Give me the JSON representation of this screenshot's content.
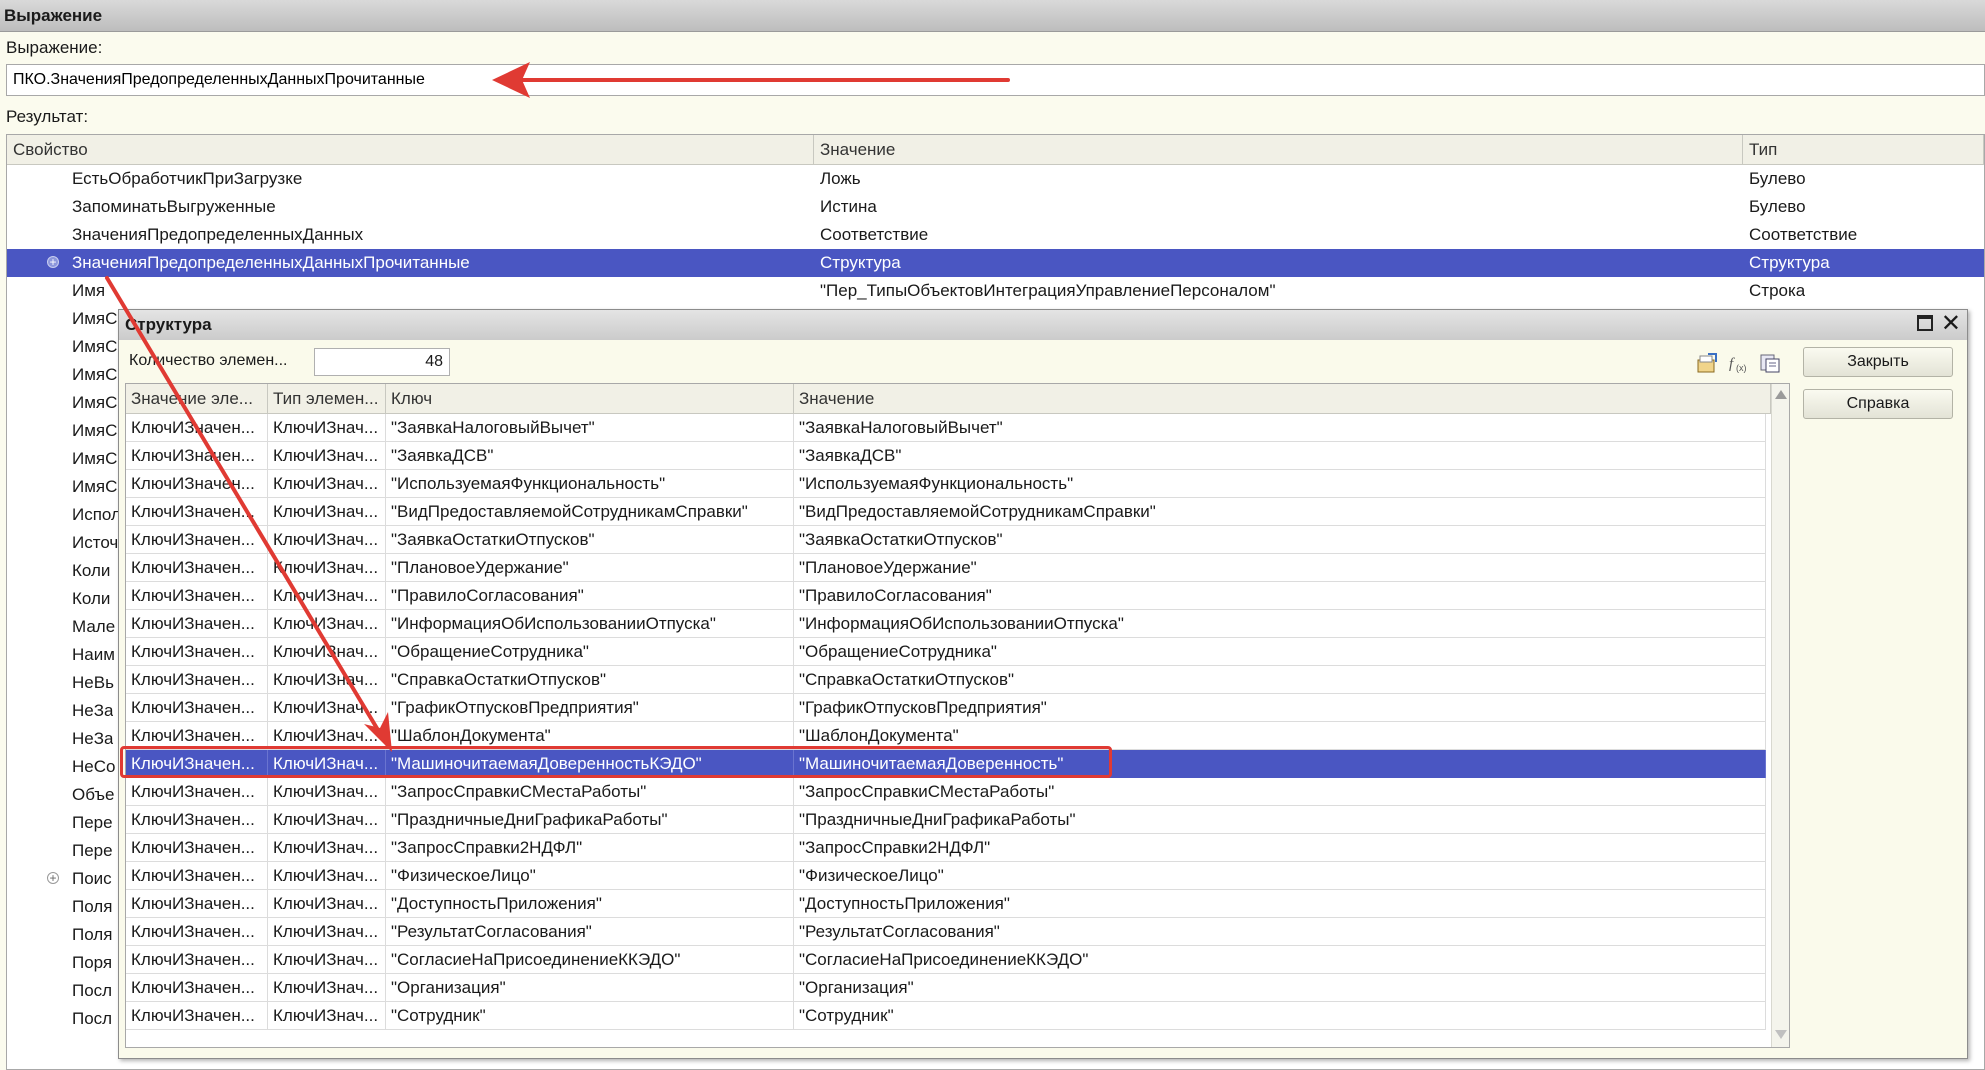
{
  "window": {
    "title": "Выражение",
    "expression_label": "Выражение:",
    "expression_value": "ПКО.ЗначенияПредопределенныхДанныхПрочитанные",
    "result_label": "Результат:"
  },
  "result_grid": {
    "columns": [
      "Свойство",
      "Значение",
      "Тип"
    ],
    "rows": [
      {
        "prop": "ЕстьОбработчикПриЗагрузке",
        "value": "Ложь",
        "type": "Булево"
      },
      {
        "prop": "ЗапоминатьВыгруженные",
        "value": "Истина",
        "type": "Булево"
      },
      {
        "prop": "ЗначенияПредопределенныхДанных",
        "value": "Соответствие",
        "type": "Соответствие"
      },
      {
        "prop": "ЗначенияПредопределенныхДанныхПрочитанные",
        "value": "Структура",
        "type": "Структура",
        "selected": true,
        "expander": "+"
      },
      {
        "prop": "Имя",
        "value": "\"Пер_ТипыОбъектовИнтеграцияУправлениеПерсоналом\"",
        "type": "Строка"
      },
      {
        "prop": "ИмяС",
        "value": "",
        "type": ""
      },
      {
        "prop": "ИмяС",
        "value": "",
        "type": ""
      },
      {
        "prop": "ИмяС",
        "value": "",
        "type": ""
      },
      {
        "prop": "ИмяС",
        "value": "",
        "type": ""
      },
      {
        "prop": "ИмяС",
        "value": "",
        "type": ""
      },
      {
        "prop": "ИмяС",
        "value": "",
        "type": ""
      },
      {
        "prop": "ИмяС",
        "value": "",
        "type": ""
      },
      {
        "prop": "Испол",
        "value": "",
        "type": ""
      },
      {
        "prop": "Источ",
        "value": "",
        "type": ""
      },
      {
        "prop": "Коли",
        "value": "",
        "type": ""
      },
      {
        "prop": "Коли",
        "value": "",
        "type": ""
      },
      {
        "prop": "Мале",
        "value": "",
        "type": ""
      },
      {
        "prop": "Наим",
        "value": "",
        "type": ""
      },
      {
        "prop": "НеВь",
        "value": "",
        "type": ""
      },
      {
        "prop": "НеЗа",
        "value": "",
        "type": ""
      },
      {
        "prop": "НеЗа",
        "value": "",
        "type": ""
      },
      {
        "prop": "НеСо",
        "value": "",
        "type": ""
      },
      {
        "prop": "Объе",
        "value": "",
        "type": ""
      },
      {
        "prop": "Пере",
        "value": "",
        "type": ""
      },
      {
        "prop": "Пере",
        "value": "",
        "type": ""
      },
      {
        "prop": "Поис",
        "value": "",
        "type": "",
        "expander": "+"
      },
      {
        "prop": "Поля",
        "value": "",
        "type": ""
      },
      {
        "prop": "Поля",
        "value": "",
        "type": ""
      },
      {
        "prop": "Поря",
        "value": "",
        "type": ""
      },
      {
        "prop": "Посл",
        "value": "",
        "type": ""
      },
      {
        "prop": "Посл",
        "value": "",
        "type": ""
      }
    ]
  },
  "structure_dialog": {
    "title": "Структура",
    "count_label": "Количество элемен...",
    "count_value": "48",
    "close_button": "Закрыть",
    "help_button": "Справка",
    "icons": [
      "open-value-icon",
      "fx-expression-icon",
      "copy-icon"
    ],
    "columns": [
      "Значение эле...",
      "Тип элемен...",
      "Ключ",
      "Значение"
    ],
    "rows": [
      {
        "c1": "КлючИЗначен...",
        "c2": "КлючИЗнач...",
        "key": "\"ЗаявкаНалоговыйВычет\"",
        "val": "\"ЗаявкаНалоговыйВычет\""
      },
      {
        "c1": "КлючИЗначен...",
        "c2": "КлючИЗнач...",
        "key": "\"ЗаявкаДСВ\"",
        "val": "\"ЗаявкаДСВ\""
      },
      {
        "c1": "КлючИЗначен...",
        "c2": "КлючИЗнач...",
        "key": "\"ИспользуемаяФункциональность\"",
        "val": "\"ИспользуемаяФункциональность\""
      },
      {
        "c1": "КлючИЗначен...",
        "c2": "КлючИЗнач...",
        "key": "\"ВидПредоставляемойСотрудникамСправки\"",
        "val": "\"ВидПредоставляемойСотрудникамСправки\""
      },
      {
        "c1": "КлючИЗначен...",
        "c2": "КлючИЗнач...",
        "key": "\"ЗаявкаОстаткиОтпусков\"",
        "val": "\"ЗаявкаОстаткиОтпусков\""
      },
      {
        "c1": "КлючИЗначен...",
        "c2": "КлючИЗнач...",
        "key": "\"ПлановоеУдержание\"",
        "val": "\"ПлановоеУдержание\""
      },
      {
        "c1": "КлючИЗначен...",
        "c2": "КлючИЗнач...",
        "key": "\"ПравилоСогласования\"",
        "val": "\"ПравилоСогласования\""
      },
      {
        "c1": "КлючИЗначен...",
        "c2": "КлючИЗнач...",
        "key": "\"ИнформацияОбИспользованииОтпуска\"",
        "val": "\"ИнформацияОбИспользованииОтпуска\""
      },
      {
        "c1": "КлючИЗначен...",
        "c2": "КлючИЗнач...",
        "key": "\"ОбращениеСотрудника\"",
        "val": "\"ОбращениеСотрудника\""
      },
      {
        "c1": "КлючИЗначен...",
        "c2": "КлючИЗнач...",
        "key": "\"СправкаОстаткиОтпусков\"",
        "val": "\"СправкаОстаткиОтпусков\""
      },
      {
        "c1": "КлючИЗначен...",
        "c2": "КлючИЗнач...",
        "key": "\"ГрафикОтпусковПредприятия\"",
        "val": "\"ГрафикОтпусковПредприятия\""
      },
      {
        "c1": "КлючИЗначен...",
        "c2": "КлючИЗнач...",
        "key": "\"ШаблонДокумента\"",
        "val": "\"ШаблонДокумента\""
      },
      {
        "c1": "КлючИЗначен...",
        "c2": "КлючИЗнач...",
        "key": "\"МашиночитаемаяДоверенностьКЭДО\"",
        "val": "\"МашиночитаемаяДоверенность\"",
        "selected": true
      },
      {
        "c1": "КлючИЗначен...",
        "c2": "КлючИЗнач...",
        "key": "\"ЗапросСправкиСМестаРаботы\"",
        "val": "\"ЗапросСправкиСМестаРаботы\""
      },
      {
        "c1": "КлючИЗначен...",
        "c2": "КлючИЗнач...",
        "key": "\"ПраздничныеДниГрафикаРаботы\"",
        "val": "\"ПраздничныеДниГрафикаРаботы\""
      },
      {
        "c1": "КлючИЗначен...",
        "c2": "КлючИЗнач...",
        "key": "\"ЗапросСправки2НДФЛ\"",
        "val": "\"ЗапросСправки2НДФЛ\""
      },
      {
        "c1": "КлючИЗначен...",
        "c2": "КлючИЗнач...",
        "key": "\"ФизическоеЛицо\"",
        "val": "\"ФизическоеЛицо\""
      },
      {
        "c1": "КлючИЗначен...",
        "c2": "КлючИЗнач...",
        "key": "\"ДоступностьПриложения\"",
        "val": "\"ДоступностьПриложения\""
      },
      {
        "c1": "КлючИЗначен...",
        "c2": "КлючИЗнач...",
        "key": "\"РезультатСогласования\"",
        "val": "\"РезультатСогласования\""
      },
      {
        "c1": "КлючИЗначен...",
        "c2": "КлючИЗнач...",
        "key": "\"СогласиеНаПрисоединениеККЭДО\"",
        "val": "\"СогласиеНаПрисоединениеККЭДО\""
      },
      {
        "c1": "КлючИЗначен...",
        "c2": "КлючИЗнач...",
        "key": "\"Организация\"",
        "val": "\"Организация\""
      },
      {
        "c1": "КлючИЗначен...",
        "c2": "КлючИЗнач...",
        "key": "\"Сотрудник\"",
        "val": "\"Сотрудник\""
      }
    ]
  },
  "colors": {
    "selection": "#4a56c2",
    "annotation_red": "#e03a33",
    "background": "#fbfbee"
  }
}
